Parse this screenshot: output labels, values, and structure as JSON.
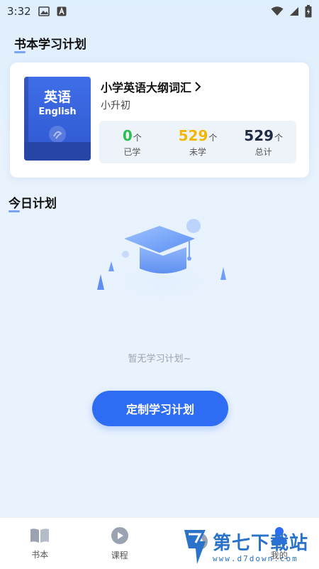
{
  "status_bar": {
    "time": "3:32"
  },
  "plan_section": {
    "title": "书本学习计划"
  },
  "book": {
    "title": "小学英语大纲词汇",
    "subtitle": "小升初",
    "cover_cn": "英语",
    "cover_en": "English",
    "stats": [
      {
        "value": "0",
        "unit": "个",
        "label": "已学",
        "color": "#2cbf4f"
      },
      {
        "value": "529",
        "unit": "个",
        "label": "未学",
        "color": "#f2b705"
      },
      {
        "value": "529",
        "unit": "个",
        "label": "总计",
        "color": "#1f2a44"
      }
    ]
  },
  "today_section": {
    "title": "今日计划",
    "empty_text": "暂无学习计划~"
  },
  "cta": {
    "label": "定制学习计划"
  },
  "tab_bar": {
    "items": [
      {
        "label": "书本",
        "icon": "book-icon"
      },
      {
        "label": "课程",
        "icon": "play-icon"
      },
      {
        "label": "",
        "icon": "compass-icon"
      },
      {
        "label": "我的",
        "icon": "user-icon"
      }
    ]
  },
  "watermark": {
    "text": "第七下载站",
    "url": "www.d7down.com"
  },
  "colors": {
    "accent": "#2d6cf3"
  }
}
